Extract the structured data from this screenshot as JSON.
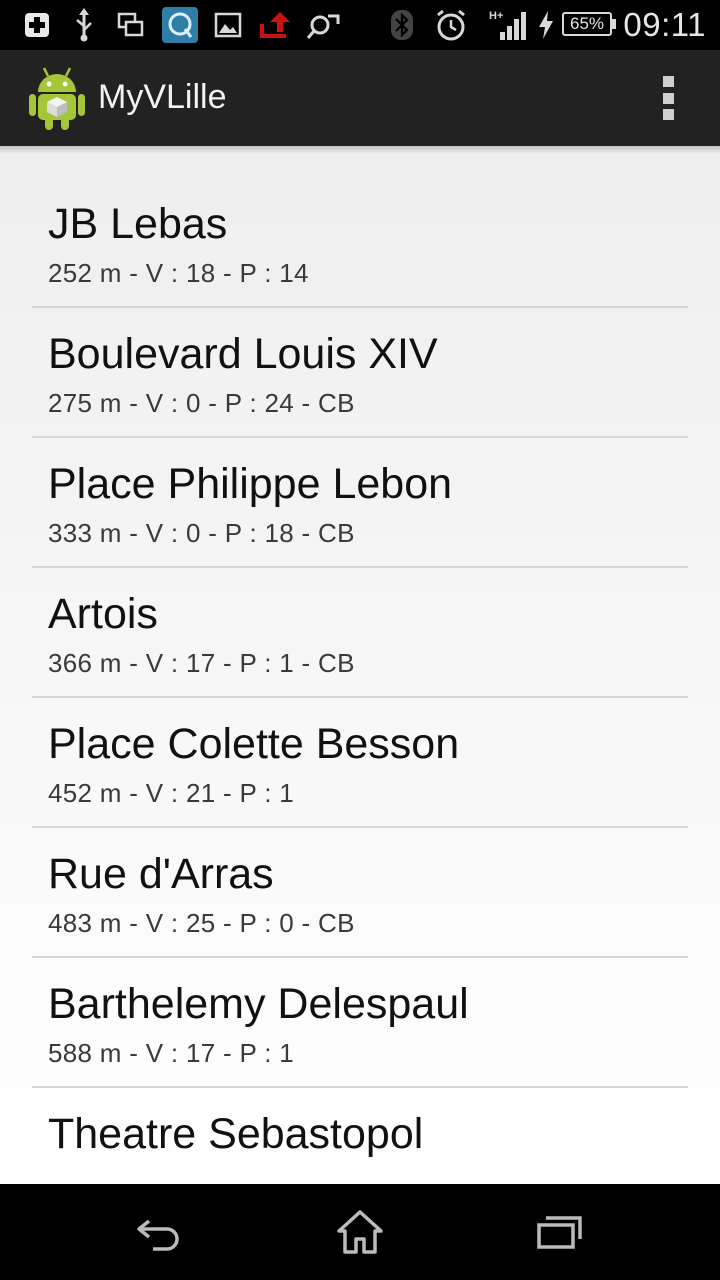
{
  "status_bar": {
    "time": "09:11",
    "battery": "65%",
    "icons": [
      "plus-icon",
      "usb-icon",
      "screens-icon",
      "q-app-icon",
      "image-icon",
      "upload-icon",
      "sync-icon",
      "bluetooth-icon",
      "alarm-icon",
      "signal-icon",
      "charging-icon",
      "battery-icon"
    ]
  },
  "action_bar": {
    "title": "MyVLille",
    "logo": "android-icon",
    "overflow": "overflow-menu-icon"
  },
  "stations": [
    {
      "name": "JB Lebas",
      "info": "252 m - V : 18 - P : 14"
    },
    {
      "name": "Boulevard Louis XIV",
      "info": "275 m - V : 0 - P : 24 - CB"
    },
    {
      "name": "Place Philippe Lebon",
      "info": "333 m - V : 0 - P : 18 - CB"
    },
    {
      "name": "Artois",
      "info": "366 m - V : 17 - P : 1 - CB"
    },
    {
      "name": "Place Colette Besson",
      "info": "452 m - V : 21 - P : 1"
    },
    {
      "name": "Rue d'Arras",
      "info": "483 m - V : 25 - P : 0 - CB"
    },
    {
      "name": "Barthelemy Delespaul",
      "info": "588 m - V : 17 - P : 1"
    },
    {
      "name": "Theatre Sebastopol",
      "info": ""
    }
  ],
  "nav_bar": {
    "buttons": [
      "back-icon",
      "home-icon",
      "recent-apps-icon"
    ]
  },
  "colors": {
    "action_bar": "#222222",
    "android_green": "#a4c639",
    "upload_red": "#cc1111",
    "q_app_bg": "#2f7ea8"
  }
}
